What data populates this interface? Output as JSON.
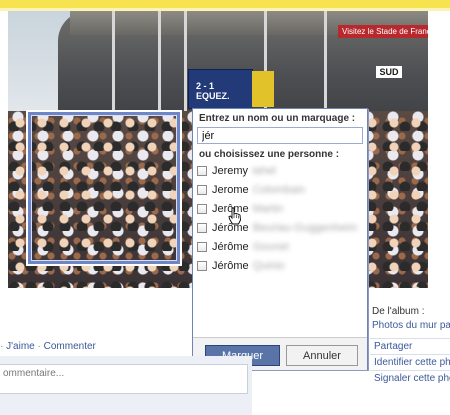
{
  "tag_dialog": {
    "prompt": "Entrez un nom ou un marquage :",
    "input_value": "jér",
    "subtitle": "ou choisissez une personne :",
    "people": [
      {
        "first": "Jeremy",
        "last": "Iahel"
      },
      {
        "first": "Jerome",
        "last": "Colombain"
      },
      {
        "first": "Jerôme",
        "last": "Martin"
      },
      {
        "first": "Jérôme",
        "last": "Beuriau-Guggenheim"
      },
      {
        "first": "Jérôme",
        "last": "Gounet"
      },
      {
        "first": "Jérôme",
        "last": "Quinio"
      }
    ],
    "confirm_label": "Marquer",
    "cancel_label": "Annuler"
  },
  "photo": {
    "banner_top": "2 - 1",
    "banner_bottom": "EQUEZ.",
    "sign_text": "Visitez le Stade de France",
    "sign_sud": "SUD"
  },
  "post_actions": {
    "like_label": "J'aime",
    "comment_label": "Commenter",
    "separator": "·"
  },
  "comment_placeholder": "ommentaire...",
  "sidebar": {
    "album_label": "De l'album :",
    "album_link": "Photos du mur par",
    "actions": [
      "Partager",
      "Identifier cette pho",
      "Signaler cette pho"
    ]
  },
  "colors": {
    "accent": "#3b5998",
    "primary_button": "#5b74a8",
    "dialog_border": "#6d84b4",
    "tag_box": "#6f86c6"
  }
}
